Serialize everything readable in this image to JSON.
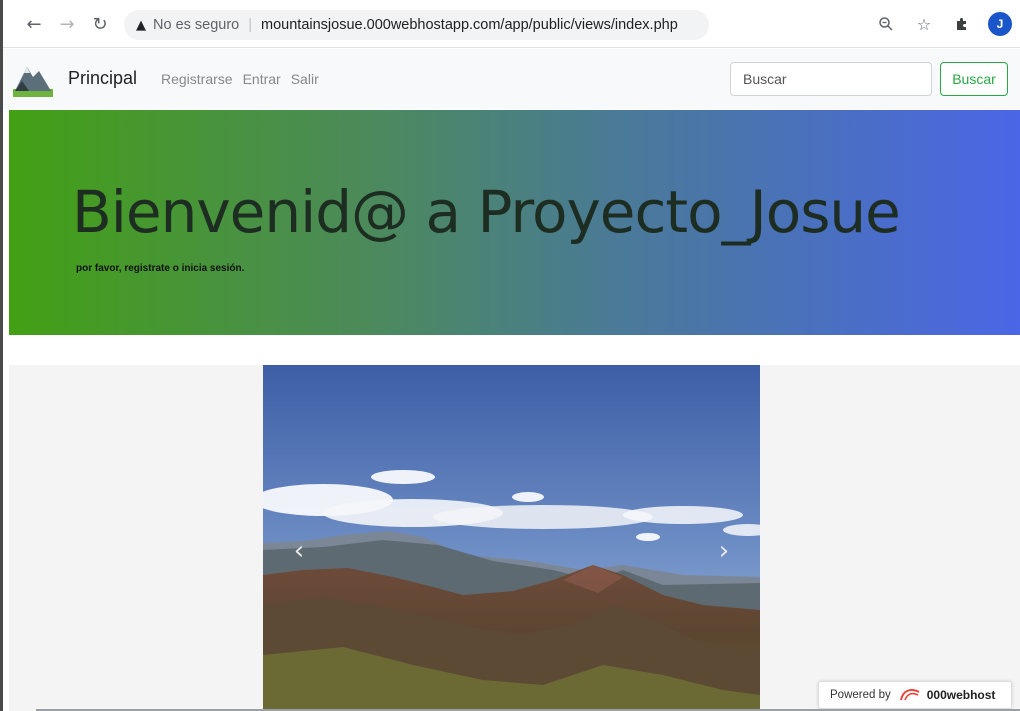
{
  "browser": {
    "security_label": "No es seguro",
    "url": "mountainsjosue.000webhostapp.com/app/public/views/index.php",
    "avatar_initial": "J"
  },
  "navbar": {
    "brand": "Principal",
    "links": [
      "Registrarse",
      "Entrar",
      "Salir"
    ],
    "search_placeholder": "Buscar",
    "search_button": "Buscar"
  },
  "hero": {
    "title": "Bienvenid@ a Proyecto_Josue",
    "subtitle": "por favor, registrate o inicia sesión."
  },
  "carousel": {
    "prev_icon": "chevron-left-icon",
    "next_icon": "chevron-right-icon"
  },
  "badge": {
    "prefix": "Powered by",
    "brand": "000webhost"
  },
  "colors": {
    "hero_start": "#43a014",
    "hero_end": "#4b66e6",
    "search_button": "#28a745"
  }
}
